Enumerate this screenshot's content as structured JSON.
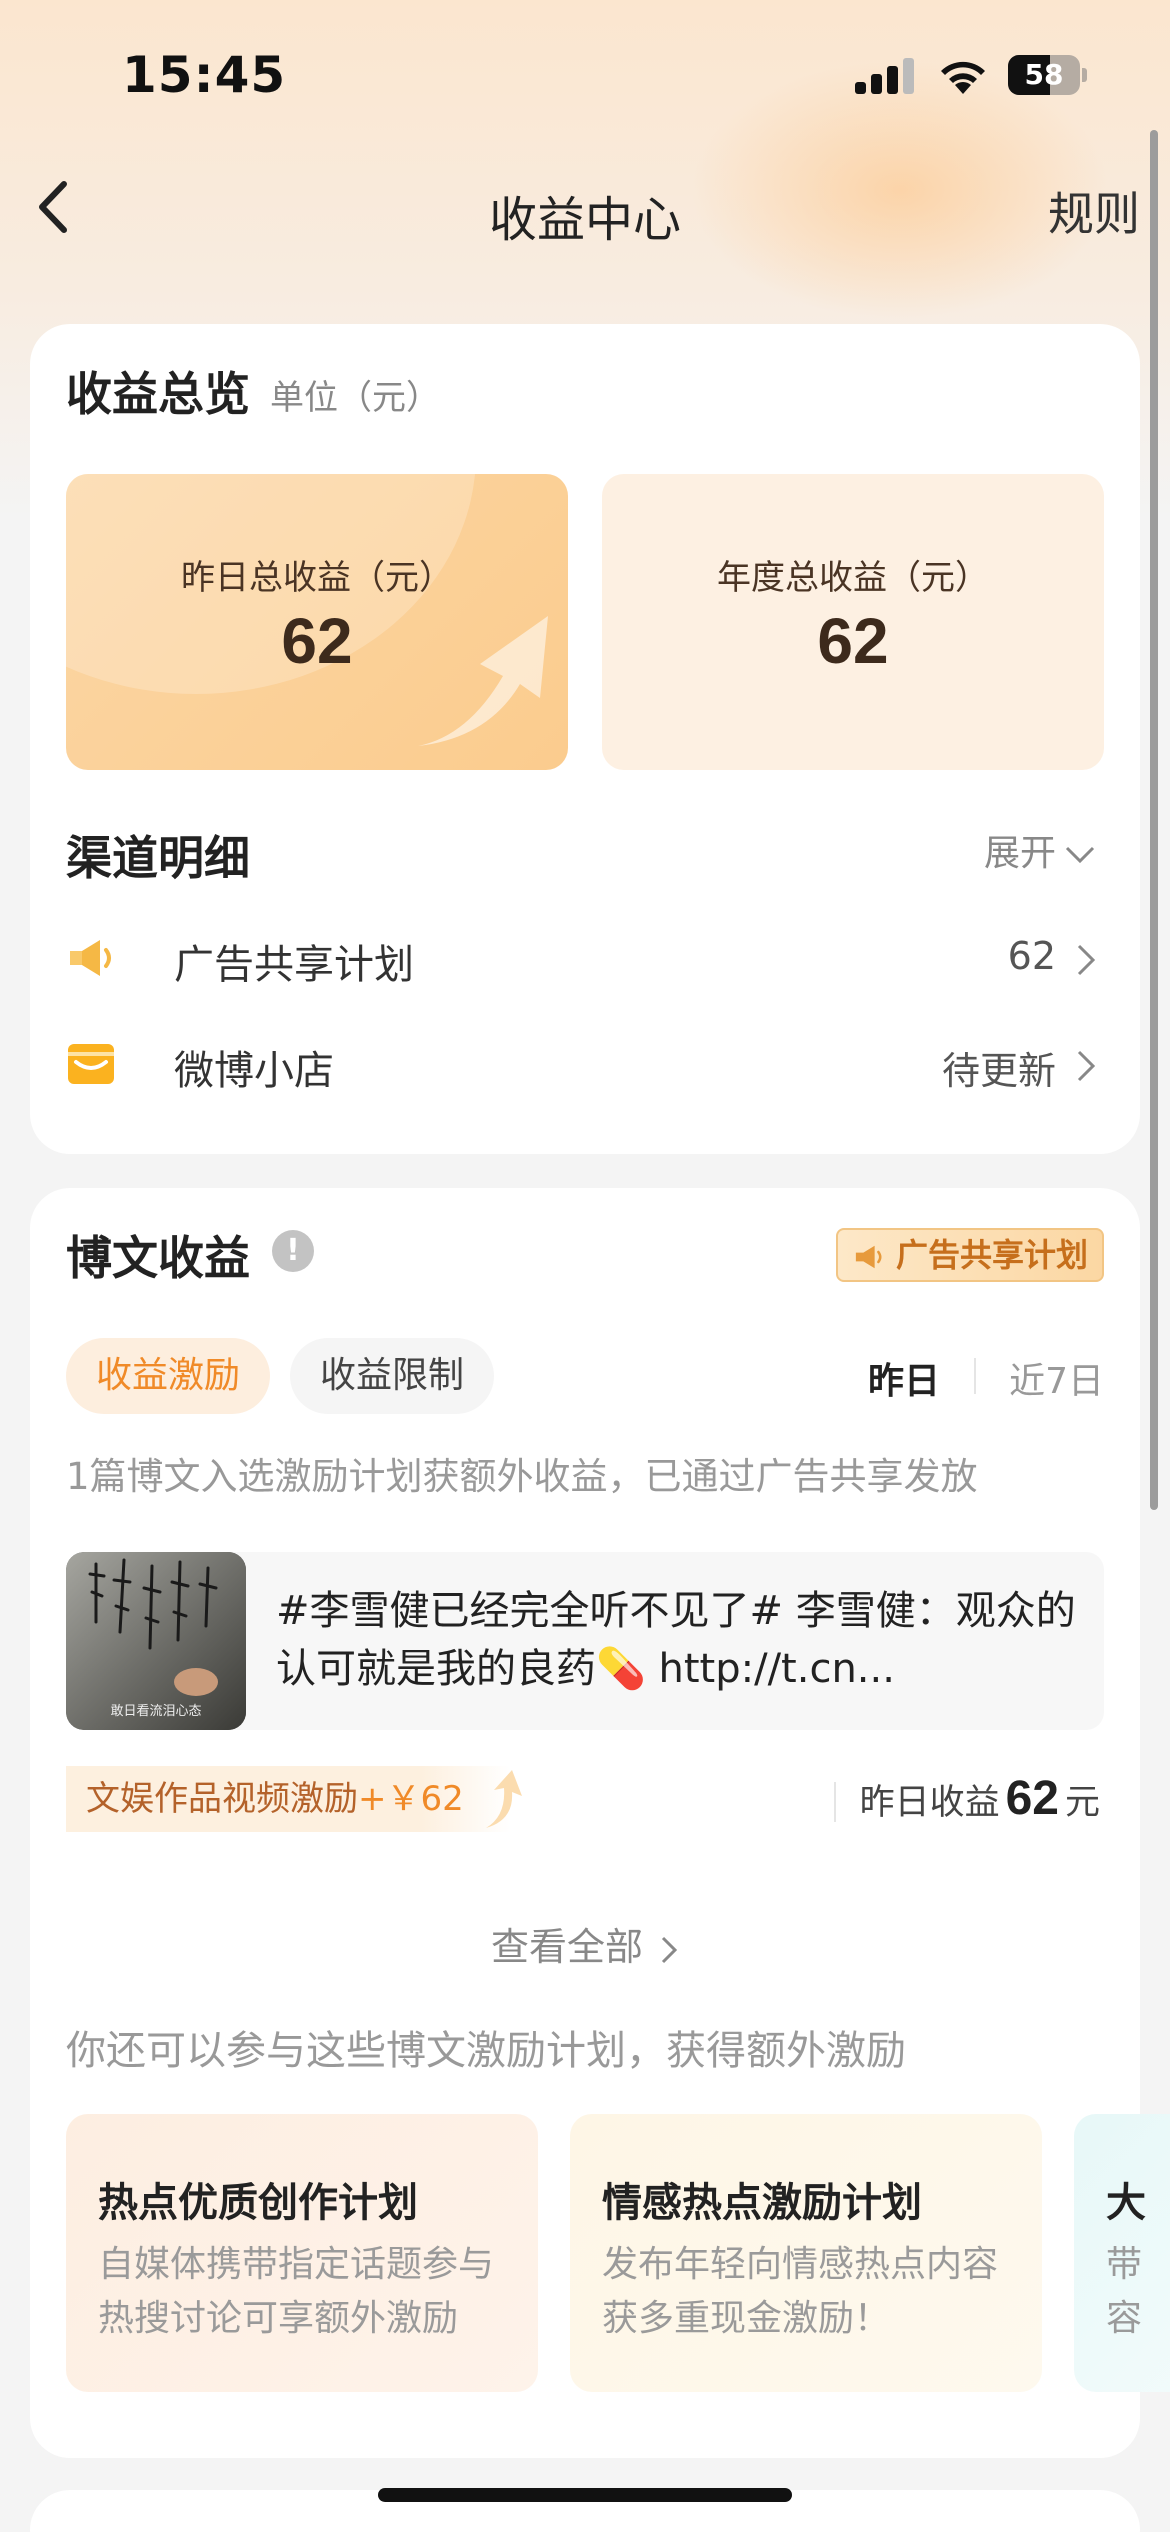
{
  "status_bar": {
    "time": "15:45",
    "battery": "58",
    "battery_level": 0.58
  },
  "nav": {
    "title": "收益中心",
    "rules": "规则"
  },
  "overview": {
    "title": "收益总览",
    "unit": "单位（元）",
    "yesterday_label": "昨日总收益（元）",
    "yesterday_value": "62",
    "annual_label": "年度总收益（元）",
    "annual_value": "62"
  },
  "channels": {
    "title": "渠道明细",
    "expand": "展开",
    "items": [
      {
        "label": "广告共享计划",
        "value": "62",
        "icon": "megaphone-icon"
      },
      {
        "label": "微博小店",
        "value": "待更新",
        "icon": "shop-icon"
      }
    ]
  },
  "post_income": {
    "title": "博文收益",
    "badge": "广告共享计划",
    "tabs": [
      "收益激励",
      "收益限制"
    ],
    "ranges": [
      "昨日",
      "近7日"
    ],
    "description": "1篇博文入选激励计划获额外收益，已通过广告共享发放",
    "post": {
      "text": "#李雪健已经完全听不见了# 李雪健：观众的认可就是我的良药💊 http://t.cn...",
      "thumb_caption": "敢日看流泪心态"
    },
    "reward_label": "文娱作品视频激励",
    "reward_amount": "+￥62",
    "yesterday_label": "昨日收益",
    "yesterday_value": "62",
    "yesterday_unit": "元",
    "view_all": "查看全部",
    "more_description": "你还可以参与这些博文激励计划，获得额外激励",
    "plans": [
      {
        "title": "热点优质创作计划",
        "desc": "自媒体携带指定话题参与热搜讨论可享额外激励"
      },
      {
        "title": "情感热点激励计划",
        "desc": "发布年轻向情感热点内容获多重现金激励！"
      },
      {
        "title": "大",
        "desc": "带容"
      }
    ]
  },
  "colors": {
    "accent": "#f08a28",
    "badge_text": "#c66f1c",
    "stat_left_bg": "#fbd6a4",
    "stat_right_bg": "#fdf0e2"
  }
}
